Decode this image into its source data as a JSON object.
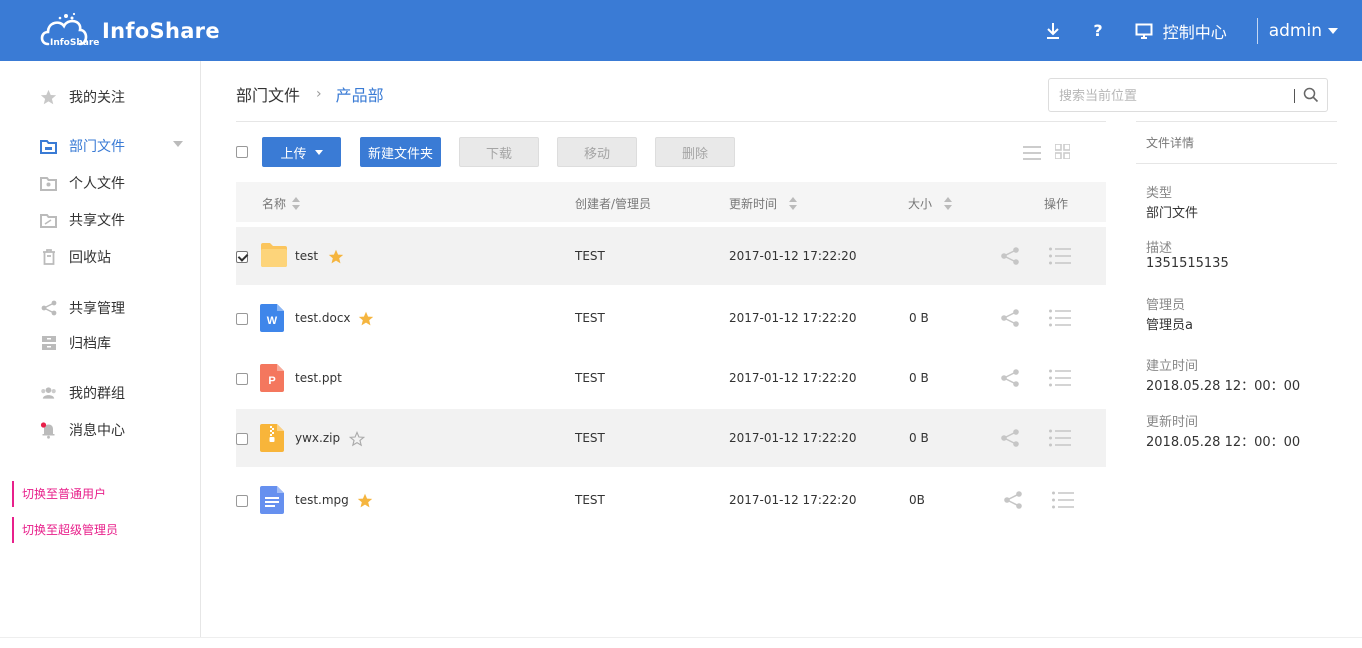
{
  "header": {
    "brand": "InfoShare",
    "brand_sub": "InfoShare",
    "help": "?",
    "control_center": "控制中心",
    "user": "admin",
    "bg_color": "#3a7bd5"
  },
  "sidebar": {
    "items": [
      {
        "label": "我的关注",
        "icon": "star-icon"
      },
      {
        "label": "部门文件",
        "icon": "folder-icon"
      },
      {
        "label": "个人文件",
        "icon": "personal-folder-icon"
      },
      {
        "label": "共享文件",
        "icon": "shared-folder-icon"
      },
      {
        "label": "回收站",
        "icon": "trash-icon"
      },
      {
        "label": "共享管理",
        "icon": "share-icon"
      },
      {
        "label": "归档库",
        "icon": "archive-icon"
      },
      {
        "label": "我的群组",
        "icon": "group-icon"
      },
      {
        "label": "消息中心",
        "icon": "bell-icon"
      }
    ],
    "switch_normal": "切换至普通用户",
    "switch_super": "切换至超级管理员",
    "accent_color": "#e8208b"
  },
  "breadcrumb": {
    "root": "部门文件",
    "separator": "›",
    "current": "产品部"
  },
  "search": {
    "placeholder": "搜索当前位置"
  },
  "toolbar": {
    "upload": "上传",
    "new_folder": "新建文件夹",
    "download": "下载",
    "move": "移动",
    "delete": "删除"
  },
  "table": {
    "headers": {
      "name": "名称",
      "creator": "创建者/管理员",
      "updated": "更新时间",
      "size": "大小",
      "actions": "操作"
    },
    "rows": [
      {
        "name": "test",
        "type": "folder",
        "creator": "TEST",
        "updated": "2017-01-12 17:22:20",
        "size": "",
        "starred": true,
        "checked": true
      },
      {
        "name": "test.docx",
        "type": "word",
        "creator": "TEST",
        "updated": "2017-01-12 17:22:20",
        "size": "0 B",
        "starred": true,
        "checked": false
      },
      {
        "name": "test.ppt",
        "type": "ppt",
        "creator": "TEST",
        "updated": "2017-01-12 17:22:20",
        "size": "0 B",
        "starred": false,
        "checked": false
      },
      {
        "name": "ywx.zip",
        "type": "zip",
        "creator": "TEST",
        "updated": "2017-01-12 17:22:20",
        "size": "0 B",
        "starred": false,
        "checked": false
      },
      {
        "name": "test.mpg",
        "type": "video",
        "creator": "TEST",
        "updated": "2017-01-12 17:22:20",
        "size": "0B",
        "starred": true,
        "checked": false
      }
    ]
  },
  "detail": {
    "title": "文件详情",
    "type_label": "类型",
    "type_value": "部门文件",
    "desc_label": "描述",
    "desc_value": "1351515135",
    "admin_label": "管理员",
    "admin_value": "管理员a",
    "created_label": "建立时间",
    "created_value": "2018.05.28 12：00：00",
    "updated_label": "更新时间",
    "updated_value": "2018.05.28 12：00：00"
  }
}
